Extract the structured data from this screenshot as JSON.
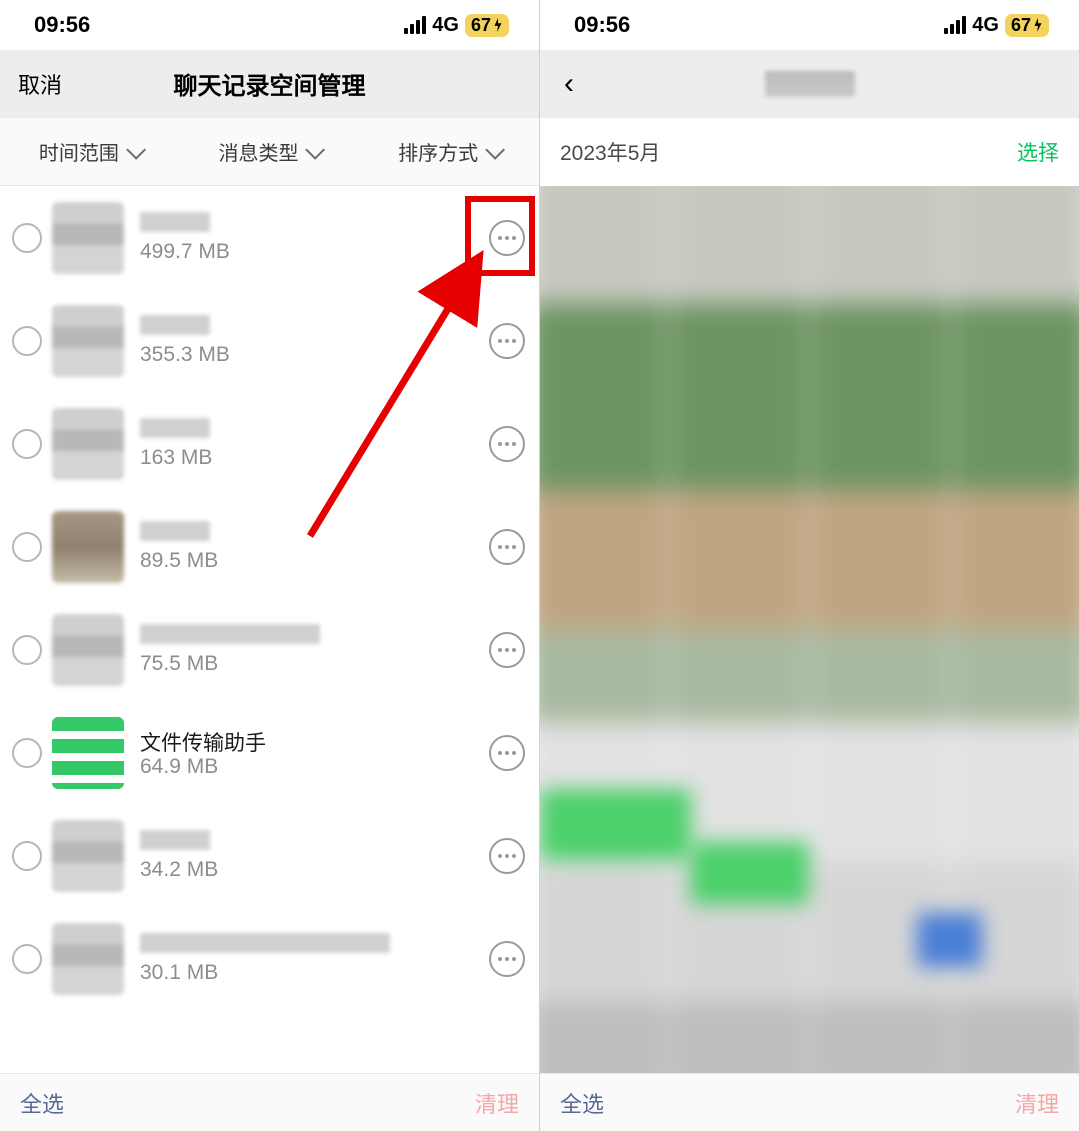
{
  "statusBar": {
    "time": "09:56",
    "network": "4G",
    "battery": "67"
  },
  "leftPanel": {
    "nav": {
      "cancel": "取消",
      "title": "聊天记录空间管理"
    },
    "filters": {
      "timeRange": "时间范围",
      "msgType": "消息类型",
      "sortBy": "排序方式"
    },
    "items": [
      {
        "name": "",
        "size": "499.7 MB"
      },
      {
        "name": "",
        "size": "355.3 MB"
      },
      {
        "name": "",
        "size": "163 MB"
      },
      {
        "name": "",
        "size": "89.5 MB"
      },
      {
        "name": "",
        "size": "75.5 MB"
      },
      {
        "name": "文件传输助手",
        "size": "64.9 MB"
      },
      {
        "name": "",
        "size": "34.2 MB"
      },
      {
        "name": "",
        "size": "30.1 MB"
      }
    ],
    "bottom": {
      "selectAll": "全选",
      "clean": "清理"
    }
  },
  "rightPanel": {
    "dateLabel": "2023年5月",
    "selectLabel": "选择",
    "bottom": {
      "selectAll": "全选",
      "clean": "清理"
    }
  },
  "annotation": {
    "arrowColor": "#e60000"
  }
}
